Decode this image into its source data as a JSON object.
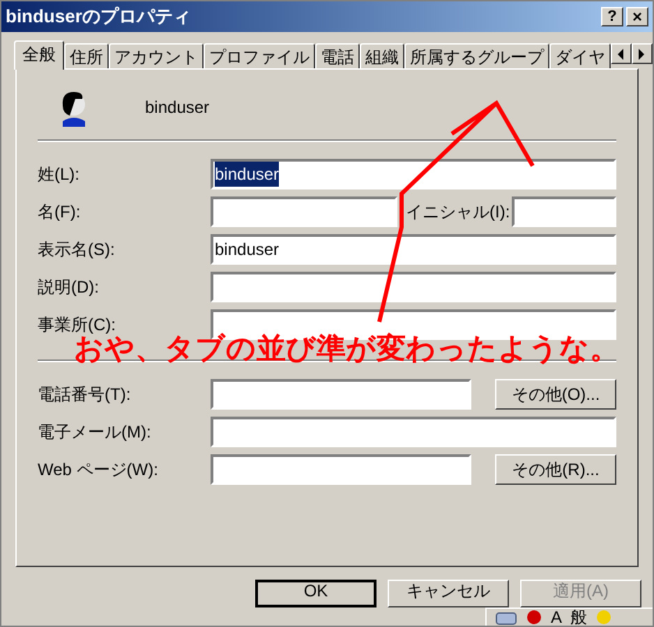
{
  "window": {
    "title": "binduserのプロパティ",
    "title_buttons": [
      {
        "kind": "help",
        "label": "?"
      },
      {
        "kind": "close",
        "label": "×"
      }
    ]
  },
  "tabs": [
    {
      "label": "全般",
      "selected": true
    },
    {
      "label": "住所",
      "selected": false
    },
    {
      "label": "アカウント",
      "selected": false
    },
    {
      "label": "プロファイル",
      "selected": false
    },
    {
      "label": "電話",
      "selected": false
    },
    {
      "label": "組織",
      "selected": false
    },
    {
      "label": "所属するグループ",
      "selected": false
    },
    {
      "label": "ダイヤ",
      "selected": false
    }
  ],
  "user": {
    "name": "binduser"
  },
  "name_fields": [
    {
      "kind": "full",
      "label": "姓(L):",
      "value": "binduser",
      "highlighted": true
    },
    {
      "kind": "initials",
      "label": "名(F):",
      "initials_label": "イニシャル(I):"
    },
    {
      "kind": "full",
      "label": "表示名(S):",
      "value": "binduser",
      "highlighted": false
    },
    {
      "kind": "full",
      "label": "説明(D):"
    },
    {
      "kind": "full",
      "label": "事業所(C):"
    }
  ],
  "contact_fields": [
    {
      "kind": "button",
      "label": "電話番号(T):",
      "button": "その他(O)..."
    },
    {
      "kind": "full",
      "label": "電子メール(M):"
    },
    {
      "kind": "button",
      "label": "Web ページ(W):",
      "button": "その他(R)..."
    }
  ],
  "annotation": {
    "text": "おや、タブの並び準が変わったような。"
  },
  "buttons": [
    {
      "label": "OK",
      "default": true,
      "disabled": false
    },
    {
      "label": "キャンセル",
      "default": false,
      "disabled": false
    },
    {
      "label": "適用(A)",
      "default": false,
      "disabled": true
    }
  ],
  "ime_bar": {
    "mode": "A",
    "input": "般"
  }
}
